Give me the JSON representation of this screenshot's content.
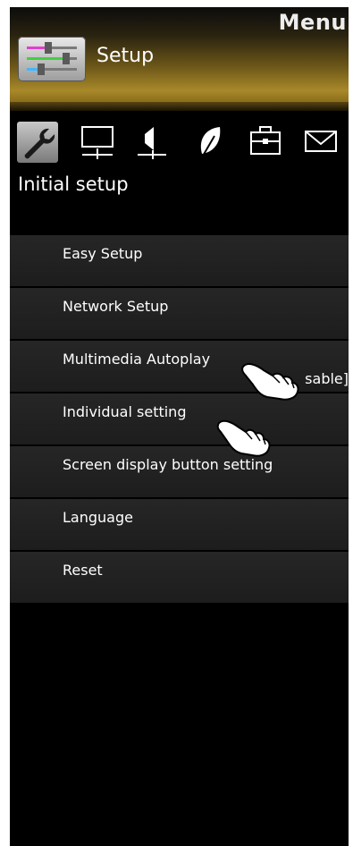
{
  "header": {
    "menu_title": "Menu",
    "setup_title": "Setup"
  },
  "categories": [
    {
      "icon": "wrench-icon",
      "active": true
    },
    {
      "icon": "monitor-icon",
      "active": false
    },
    {
      "icon": "speaker-icon",
      "active": false
    },
    {
      "icon": "leaf-icon",
      "active": false
    },
    {
      "icon": "toolbox-icon",
      "active": false
    },
    {
      "icon": "envelope-icon",
      "active": false
    }
  ],
  "section_title": "Initial setup",
  "menu": {
    "items": [
      {
        "label": "Easy Setup"
      },
      {
        "label": "Network Setup"
      },
      {
        "label": "Multimedia Autoplay",
        "suffix": "sable]"
      },
      {
        "label": "Individual setting"
      },
      {
        "label": "Screen display button setting"
      },
      {
        "label": "Language"
      },
      {
        "label": "Reset"
      }
    ]
  },
  "colors": {
    "header_gold": "#a8882a",
    "panel_bg": "#000000",
    "item_bg": "#222222",
    "text": "#ffffff"
  }
}
